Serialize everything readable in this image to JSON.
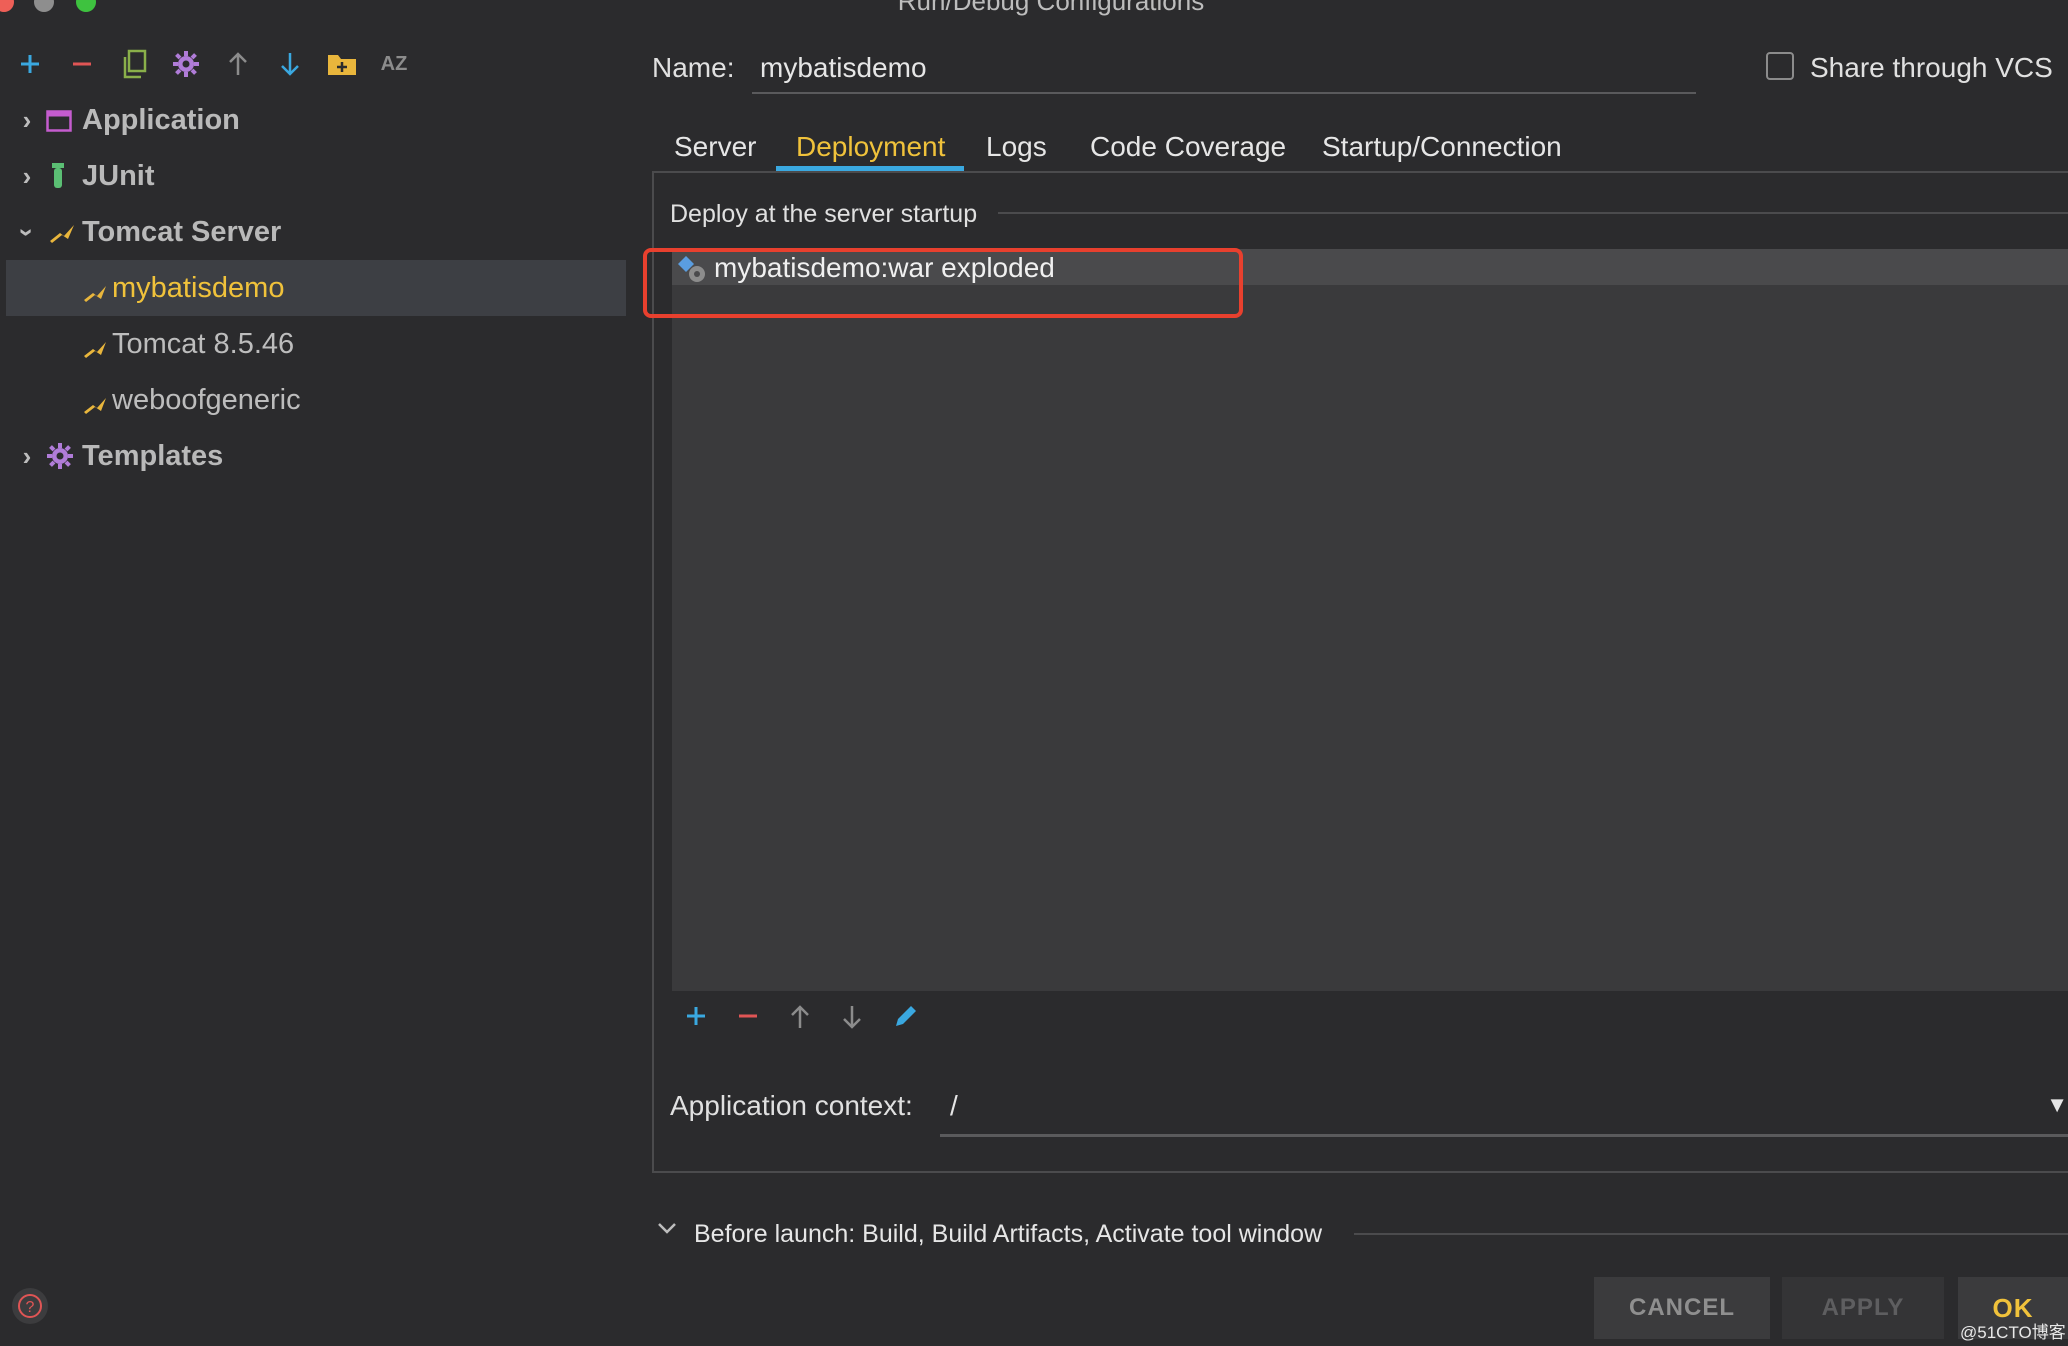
{
  "window": {
    "title": "Run/Debug Configurations"
  },
  "toolbar": {
    "icons": [
      "add-icon",
      "remove-icon",
      "copy-icon",
      "gear-icon",
      "arrow-up-icon",
      "arrow-down-icon",
      "folder-add-icon",
      "sort-az-icon"
    ],
    "sort_label": "AZ"
  },
  "tree": {
    "application": "Application",
    "junit": "JUnit",
    "tomcat_server": "Tomcat Server",
    "children": [
      "mybatisdemo",
      "Tomcat 8.5.46",
      "weboofgeneric"
    ],
    "templates": "Templates"
  },
  "name": {
    "label": "Name:",
    "value": "mybatisdemo"
  },
  "share": {
    "label": "Share through VCS",
    "checked": false
  },
  "tabs": [
    "Server",
    "Deployment",
    "Logs",
    "Code Coverage",
    "Startup/Connection"
  ],
  "active_tab": "Deployment",
  "deploy": {
    "section_title": "Deploy at the server startup",
    "items": [
      "mybatisdemo:war exploded"
    ]
  },
  "app_context": {
    "label": "Application context:",
    "value": "/"
  },
  "before_launch": "Before launch: Build, Build Artifacts, Activate tool window",
  "buttons": {
    "cancel": "CANCEL",
    "apply": "APPLY",
    "ok": "OK"
  },
  "watermark": "@51CTO博客",
  "colors": {
    "accent": "#f0c23b",
    "highlight": "#e8402e",
    "add": "#3aa8e0",
    "remove": "#e05555"
  }
}
